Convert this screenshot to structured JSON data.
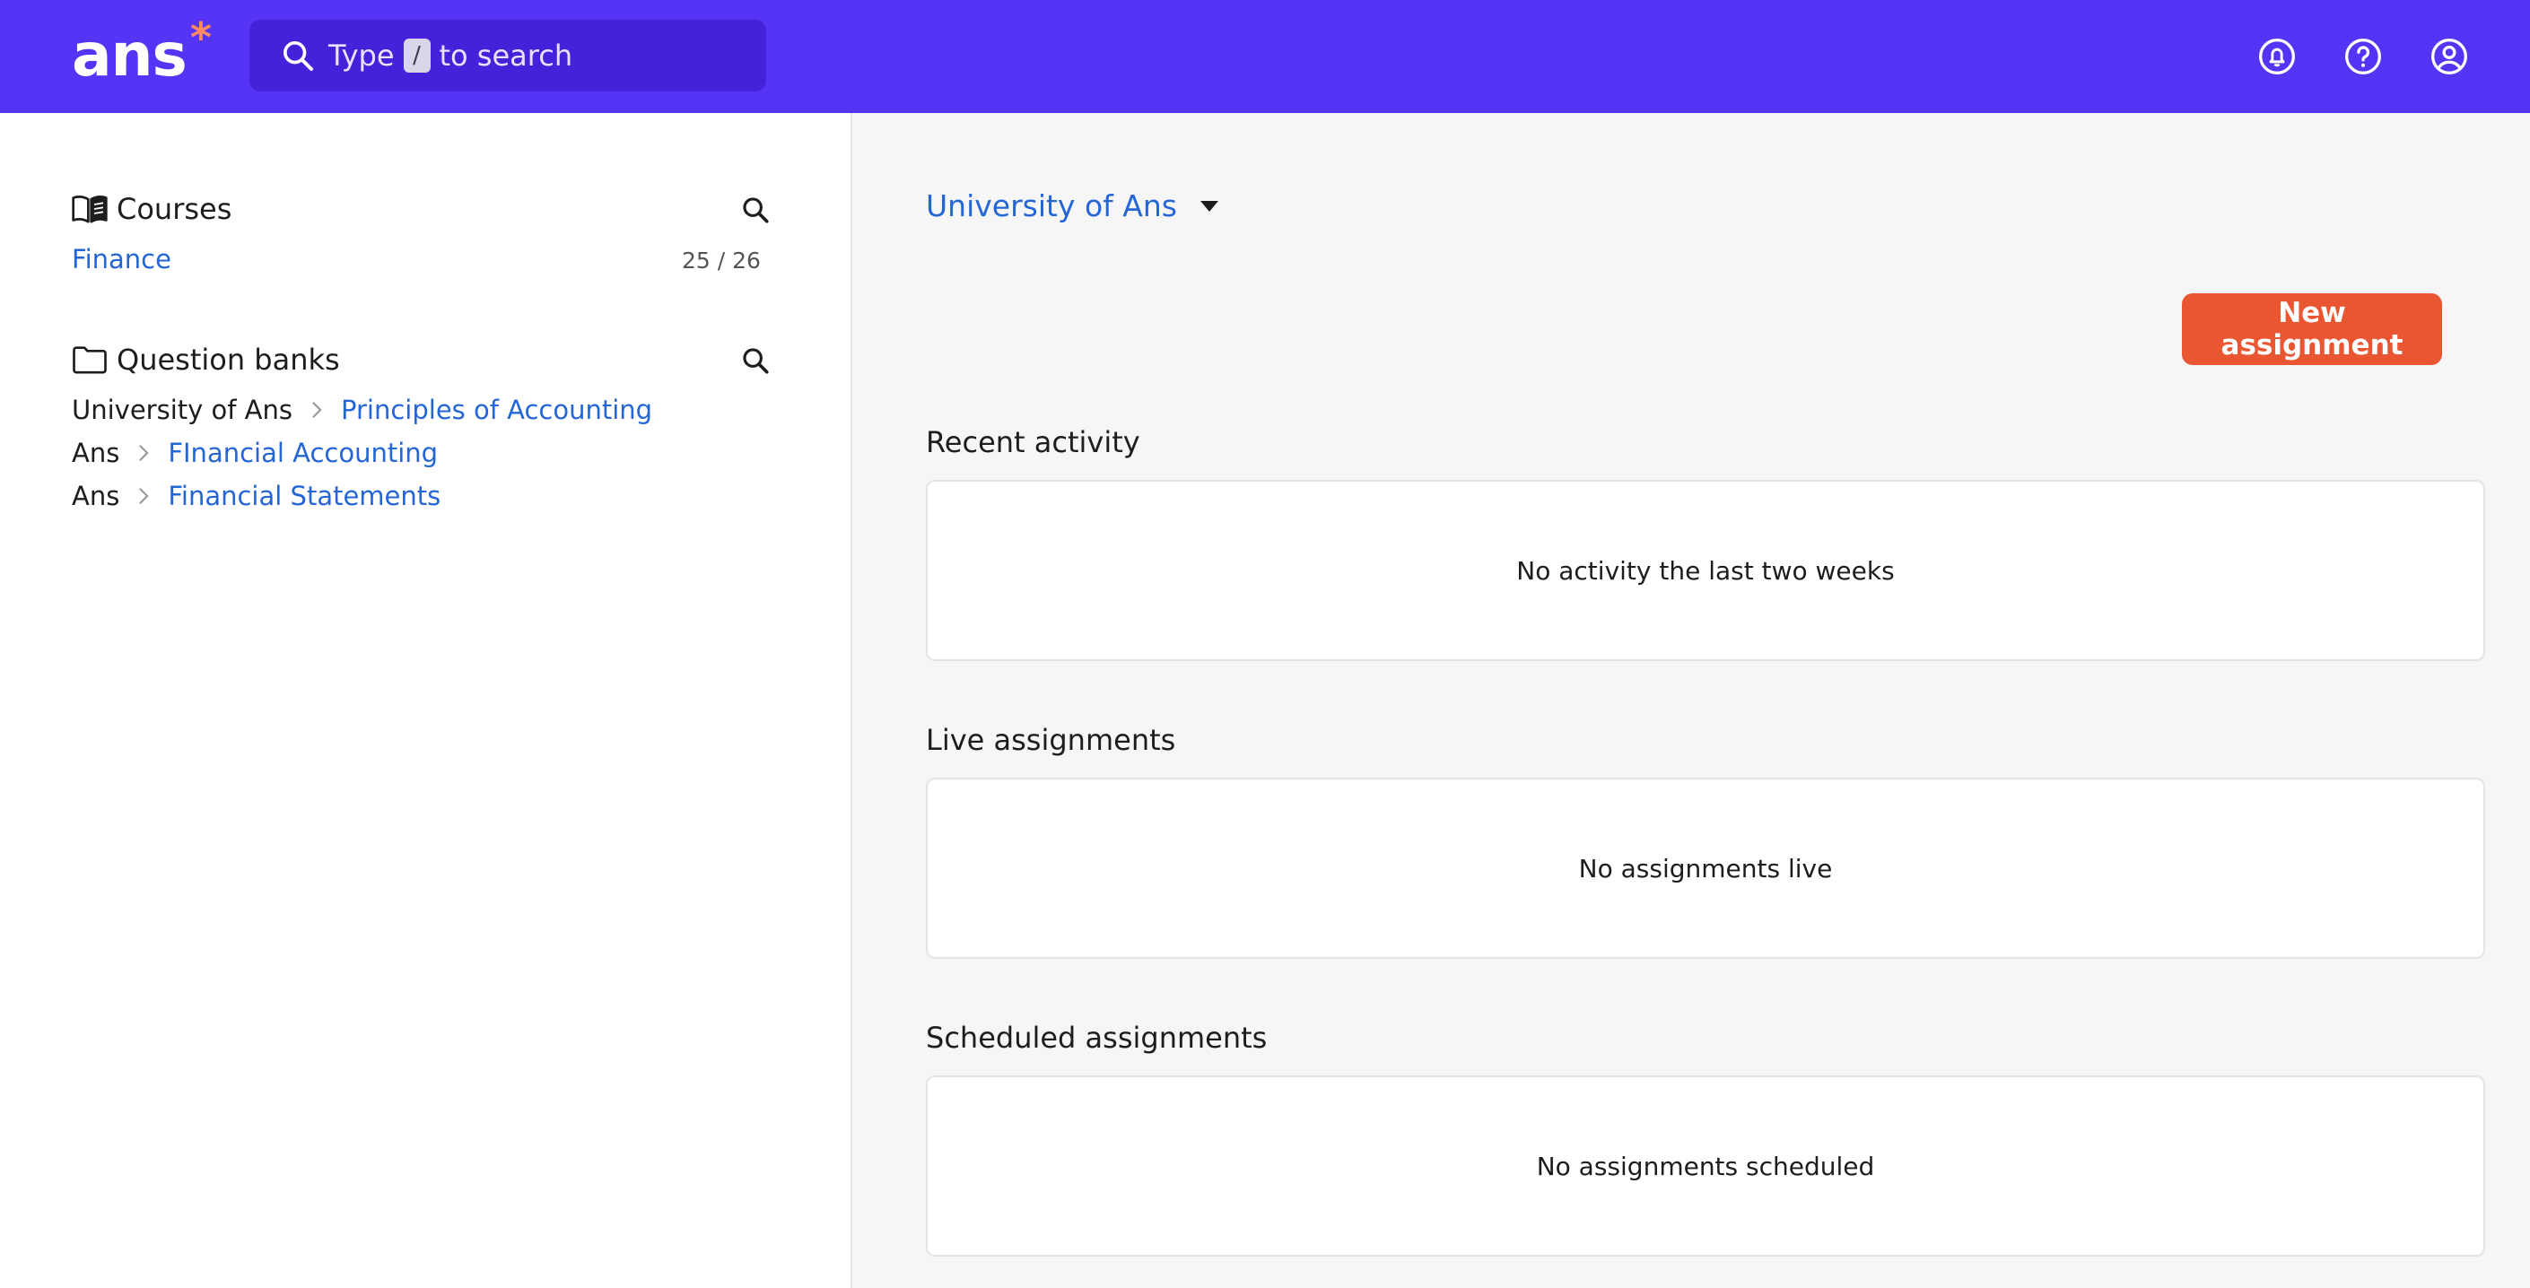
{
  "app": {
    "logo_text": "ans",
    "logo_mark": "*",
    "brand_color": "#5534f5",
    "accent_color": "#ea5532",
    "link_color": "#2466d6"
  },
  "header": {
    "search": {
      "prefix": "Type",
      "key": "/",
      "suffix": "to search",
      "icon": "search-icon"
    },
    "icons": [
      "notifications-icon",
      "help-icon",
      "account-icon"
    ]
  },
  "sidebar": {
    "courses": {
      "title": "Courses",
      "icon": "book-icon",
      "items": [
        {
          "label": "Finance",
          "count": "25 / 26"
        }
      ]
    },
    "question_banks": {
      "title": "Question banks",
      "icon": "folder-icon",
      "items": [
        {
          "parent": "University of Ans",
          "label": "Principles of Accounting"
        },
        {
          "parent": "Ans",
          "label": "FInancial Accounting"
        },
        {
          "parent": "Ans",
          "label": "Financial Statements"
        }
      ]
    }
  },
  "main": {
    "org_selector": "University of Ans",
    "new_assignment_label": "New assignment",
    "sections": [
      {
        "title": "Recent activity",
        "empty_text": "No activity the last two weeks"
      },
      {
        "title": "Live assignments",
        "empty_text": "No assignments live"
      },
      {
        "title": "Scheduled assignments",
        "empty_text": "No assignments scheduled"
      }
    ]
  }
}
